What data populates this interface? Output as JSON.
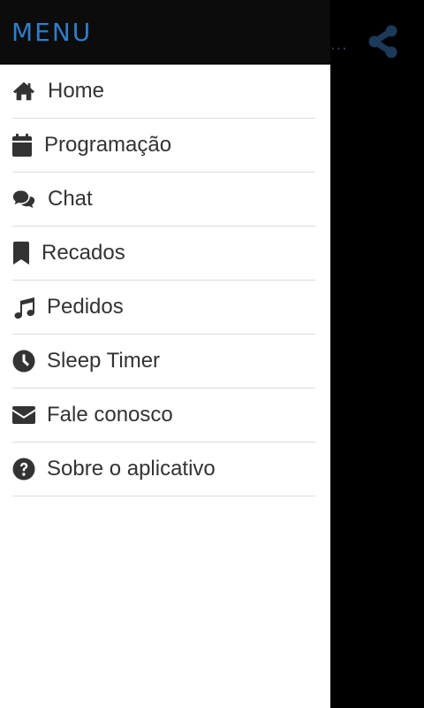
{
  "colors": {
    "header_bg": "#0c0c0c",
    "title": "#2f7ec8",
    "icon": "#333333",
    "divider": "#dcdcdc",
    "overlay": "#000000",
    "share_icon": "#1c3a59"
  },
  "header": {
    "title": "MENU"
  },
  "background": {
    "overflow_indicator": "..."
  },
  "menu": {
    "items": [
      {
        "label": "Home",
        "icon": "home-icon"
      },
      {
        "label": "Programação",
        "icon": "calendar-icon"
      },
      {
        "label": "Chat",
        "icon": "chat-icon"
      },
      {
        "label": "Recados",
        "icon": "bookmark-icon"
      },
      {
        "label": "Pedidos",
        "icon": "music-note-icon"
      },
      {
        "label": "Sleep Timer",
        "icon": "clock-icon"
      },
      {
        "label": "Fale conosco",
        "icon": "envelope-icon"
      },
      {
        "label": "Sobre o aplicativo",
        "icon": "help-icon"
      }
    ]
  }
}
